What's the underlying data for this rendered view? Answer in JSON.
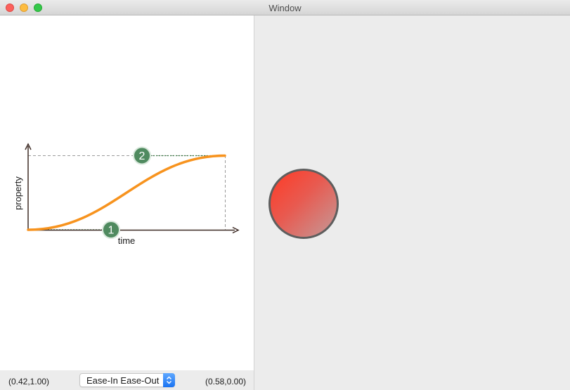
{
  "window": {
    "title": "Window"
  },
  "curve_editor": {
    "y_axis_label": "property",
    "x_axis_label": "time",
    "handle_1_label": "1",
    "handle_2_label": "2",
    "curve_color": "#f7931e",
    "handle_color": "#4f8a5f"
  },
  "bottom_bar": {
    "control_point_1": "(0.42,1.00)",
    "control_point_2": "(0.58,0.00)",
    "timing_function": {
      "selected": "Ease-In Ease-Out"
    }
  },
  "preview": {
    "ball_color": "#ff3a25"
  }
}
